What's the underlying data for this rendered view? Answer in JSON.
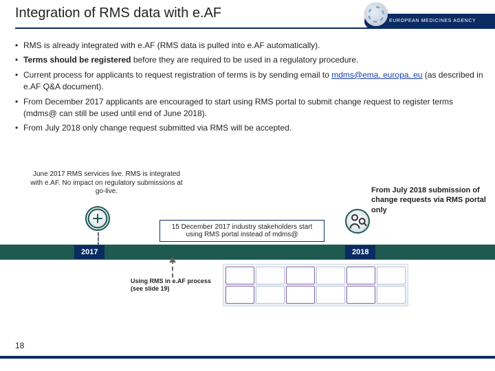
{
  "header": {
    "title": "Integration of RMS data with e.AF",
    "agency": "EUROPEAN MEDICINES AGENCY"
  },
  "bullets": {
    "b1": "RMS is already integrated with e.AF (RMS data is pulled into e.AF automatically).",
    "b2a": "Terms should be registered",
    "b2b": " before they are required to be used in a regulatory procedure.",
    "b3a": "Current process for applicants to request registration of terms is by sending email to ",
    "b3link": " mdms@ema. europa. eu",
    "b3b": " (as described in e.AF Q&A document).",
    "b4": "From December 2017 applicants are encouraged to start using RMS portal to submit change request to register terms (mdms@ can still be used until end of June 2018).",
    "b5": "From July 2018 only change request submitted via RMS will be accepted."
  },
  "timeline": {
    "callout1": "June 2017 RMS services live. RMS is integrated with e.AF. No impact on regulatory submissions at go-live.",
    "callout2": "15 December 2017 industry stakeholders start using RMS portal instead of mdms@",
    "callout3": "From July 2018 submission of change requests via RMS portal only",
    "year1": "2017",
    "year2": "2018",
    "process_label": "Using RMS in e.AF process (see slide 19)"
  },
  "footer": {
    "page": "18"
  }
}
